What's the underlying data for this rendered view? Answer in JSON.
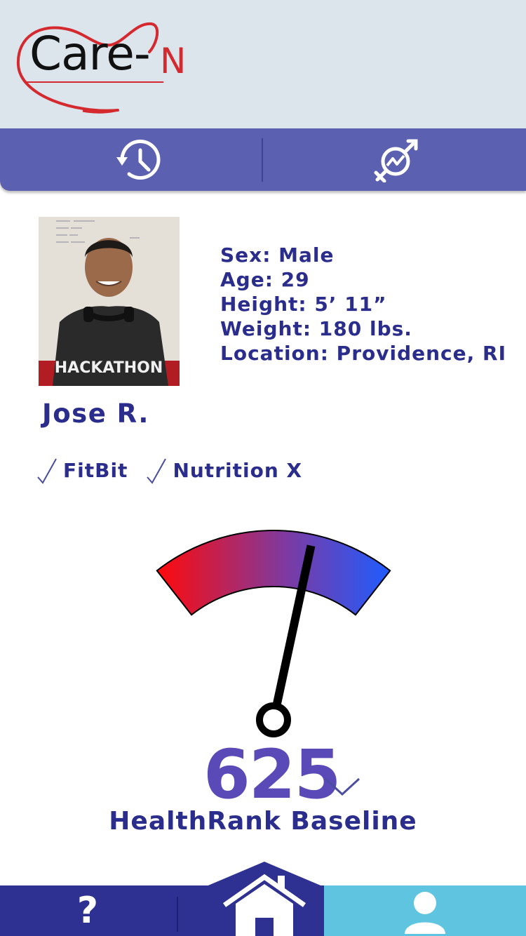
{
  "app": {
    "logo_text": "Care-",
    "logo_suffix": "N",
    "brand_red": "#d42a2f"
  },
  "topnav": {
    "history_icon": "history-icon",
    "compare_icon": "analytics-compare-icon"
  },
  "profile": {
    "name": "Jose R.",
    "sex": "Sex: Male",
    "age": "Age: 29",
    "height": "Height: 5’ 11”",
    "weight": "Weight: 180 lbs.",
    "location": "Location: Providence, RI",
    "photo_shirt_text": "HACKATHON"
  },
  "integrations": [
    {
      "label": "FitBit",
      "connected": true
    },
    {
      "label": "Nutrition X",
      "connected": true
    }
  ],
  "healthrank": {
    "score": "625",
    "label": "HealthRank Baseline",
    "gauge_fraction": 0.66,
    "gradient_start": "#ff0a0a",
    "gradient_end": "#1f5cff"
  },
  "bottomnav": {
    "help_label": "?",
    "home_icon": "home-icon",
    "profile_icon": "user-icon",
    "active": "profile"
  }
}
